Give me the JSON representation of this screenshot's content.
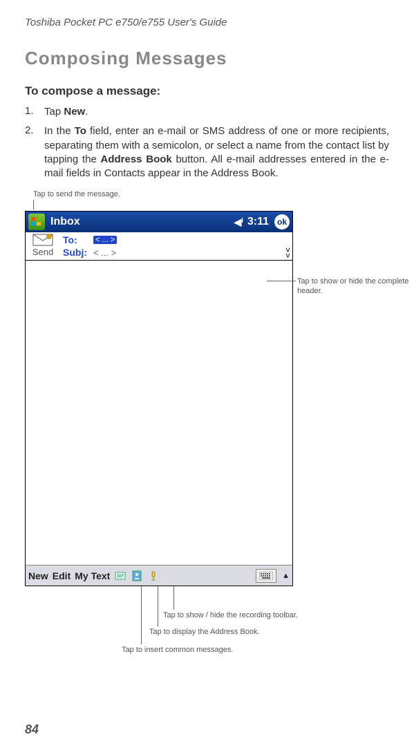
{
  "header": "Toshiba Pocket PC e750/e755  User's Guide",
  "section_title": "Composing Messages",
  "subtitle": "To compose a message:",
  "step1_num": "1.",
  "step1_pre": "Tap ",
  "step1_bold": "New",
  "step1_post": ".",
  "step2_num": "2.",
  "step2_a": "In the ",
  "step2_to": "To",
  "step2_b": " field, enter an e-mail or SMS address of one or more recipients, separating them with a semicolon, or select a name from the contact list by tapping the ",
  "step2_ab": "Address Book",
  "step2_c": " button. All e-mail ad­dresses entered in the e-mail fields in Contacts appear in the Ad­dress Book.",
  "callout_send": "Tap to send the message.",
  "ppc": {
    "title": "Inbox",
    "time": "3:11",
    "ok": "ok",
    "send_label": "Send",
    "to_label": "To:",
    "to_chip": "< ... >",
    "subj_label": "Subj:",
    "subj_val": "< ... >",
    "toolbar": {
      "new": "New",
      "edit": "Edit",
      "mytext": "My Text"
    }
  },
  "callout_header": "Tap to show or hide the complete header.",
  "tc_rec": "Tap to show / hide the recording toolbar.",
  "tc_ab": "Tap to display the Address Book.",
  "tc_common": "Tap to insert common messages.",
  "page_num": "84"
}
